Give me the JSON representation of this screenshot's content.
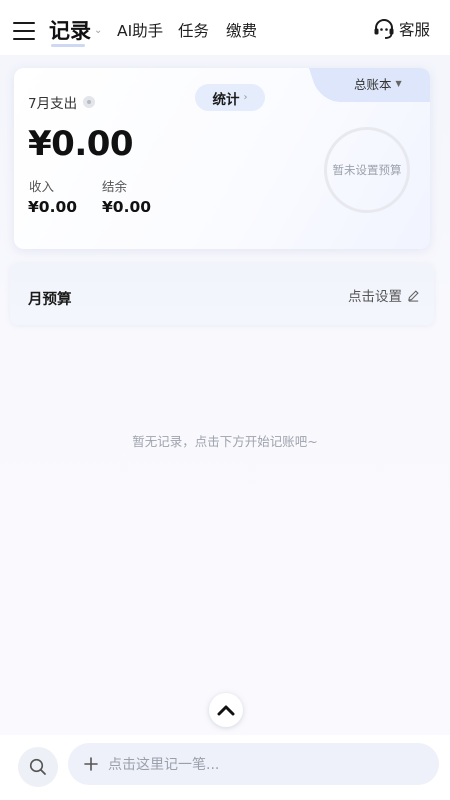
{
  "header": {
    "nav": {
      "records": "记录",
      "ai": "AI助手",
      "task": "任务",
      "pay": "缴费"
    },
    "service": "客服"
  },
  "summary": {
    "month_label": "7月支出",
    "stats_button": "统计",
    "ledger": "总账本",
    "expense": "¥0.00",
    "income_label": "收入",
    "income_value": "¥0.00",
    "balance_label": "结余",
    "balance_value": "¥0.00",
    "budget_ring_text": "暂未设置预算"
  },
  "budget": {
    "title": "月预算",
    "set_label": "点击设置"
  },
  "empty_hint": "暂无记录，点击下方开始记账吧~",
  "bottom": {
    "input_placeholder": "点击这里记一笔..."
  },
  "icons": {
    "menu": "menu-icon",
    "service": "headset-icon",
    "edit": "pencil-icon",
    "up": "chevron-up-icon",
    "search": "search-icon",
    "add": "plus-icon"
  },
  "colors": {
    "accent_soft": "#dde6fa",
    "background": "#f6f7fd",
    "text_primary": "#111111",
    "text_muted": "#9fa3ad"
  }
}
